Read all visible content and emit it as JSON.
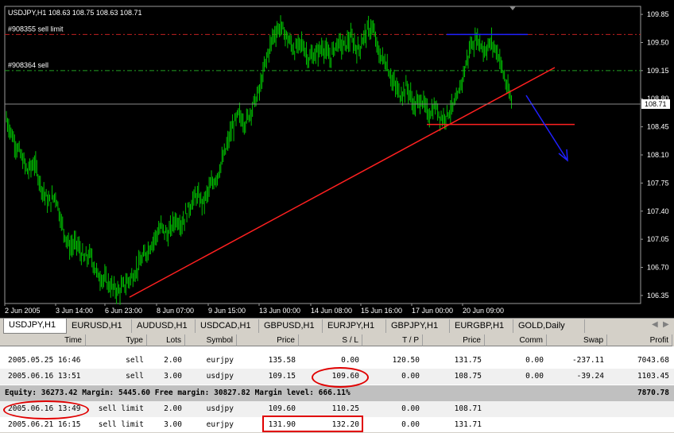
{
  "chart": {
    "symbol_label": "USDJPY,H1  108.63 108.75 108.63 108.71",
    "current_price": "108.71",
    "order_lines": [
      {
        "label": "#908355 sell limit",
        "price": 109.6,
        "color": "#c02020"
      },
      {
        "label": "#908364 sell",
        "price": 109.15,
        "color": "#20a020"
      }
    ],
    "colors": {
      "background": "#000000",
      "candles": "#00c000",
      "trendline": "#ff2020",
      "arrow": "#2020ff",
      "resistance": "#2020ff",
      "support": "#ff2020",
      "grid": "#5a5a5a"
    }
  },
  "chart_data": {
    "type": "line",
    "title": "USDJPY,H1",
    "ylim": [
      106.25,
      109.95
    ],
    "y_ticks": [
      "109.85",
      "109.50",
      "109.15",
      "108.80",
      "108.45",
      "108.10",
      "107.75",
      "107.40",
      "107.05",
      "106.70",
      "106.35"
    ],
    "x_ticks": [
      "2 Jun 2005",
      "3 Jun 14:00",
      "6 Jun 23:00",
      "8 Jun 07:00",
      "9 Jun 15:00",
      "13 Jun 00:00",
      "14 Jun 08:00",
      "15 Jun 16:00",
      "17 Jun 00:00",
      "20 Jun 09:00"
    ],
    "series": [
      {
        "values": [
          108.55,
          108.3,
          108.1,
          107.9,
          108.0,
          107.7,
          107.5,
          107.6,
          107.2,
          106.95,
          107.0,
          106.8,
          106.85,
          106.6,
          106.55,
          106.45,
          106.4,
          106.5,
          106.6,
          106.75,
          106.9,
          107.05,
          107.2,
          107.1,
          107.3,
          107.25,
          107.45,
          107.6,
          107.5,
          107.7,
          107.85,
          108.1,
          108.4,
          108.6,
          108.5,
          108.7,
          108.9,
          109.3,
          109.6,
          109.7,
          109.55,
          109.4,
          109.5,
          109.3,
          109.35,
          109.45,
          109.3,
          109.5,
          109.45,
          109.55,
          109.4,
          109.6,
          109.7,
          109.35,
          109.25,
          109.0,
          108.85,
          108.95,
          108.7,
          108.8,
          108.6,
          108.7,
          108.55,
          108.65,
          108.75,
          109.1,
          109.45,
          109.55,
          109.4,
          109.5,
          109.35,
          109.0,
          108.71
        ]
      }
    ],
    "annotations": {
      "support": 108.48,
      "resistance": 109.6
    }
  },
  "tabs": [
    {
      "label": "USDJPY,H1",
      "active": true
    },
    {
      "label": "EURUSD,H1"
    },
    {
      "label": "AUDUSD,H1"
    },
    {
      "label": "USDCAD,H1"
    },
    {
      "label": "GBPUSD,H1"
    },
    {
      "label": "EURJPY,H1"
    },
    {
      "label": "GBPJPY,H1"
    },
    {
      "label": "EURGBP,H1"
    },
    {
      "label": "GOLD,Daily"
    }
  ],
  "terminal": {
    "headers": [
      "Time",
      "Type",
      "Lots",
      "Symbol",
      "Price",
      "S / L",
      "T / P",
      "Price",
      "Comm",
      "Swap",
      "Profit"
    ],
    "positions": [
      [
        "2005.05.25 16:46",
        "sell",
        "2.00",
        "eurjpy",
        "135.58",
        "0.00",
        "120.50",
        "131.75",
        "0.00",
        "-237.11",
        "7043.68"
      ],
      [
        "2005.06.16 13:51",
        "sell",
        "3.00",
        "usdjpy",
        "109.15",
        "109.60",
        "0.00",
        "108.75",
        "0.00",
        "-39.24",
        "1103.45"
      ]
    ],
    "summary": {
      "text": "Equity: 36273.42  Margin: 5445.60  Free margin: 30827.82  Margin level: 666.11%",
      "profit": "7870.78"
    },
    "pending": [
      [
        "2005.06.16 13:49",
        "sell limit",
        "2.00",
        "usdjpy",
        "109.60",
        "110.25",
        "0.00",
        "108.71",
        "",
        "",
        ""
      ],
      [
        "2005.06.21 16:15",
        "sell limit",
        "3.00",
        "eurjpy",
        "131.90",
        "132.20",
        "0.00",
        "131.71",
        "",
        "",
        ""
      ]
    ]
  }
}
